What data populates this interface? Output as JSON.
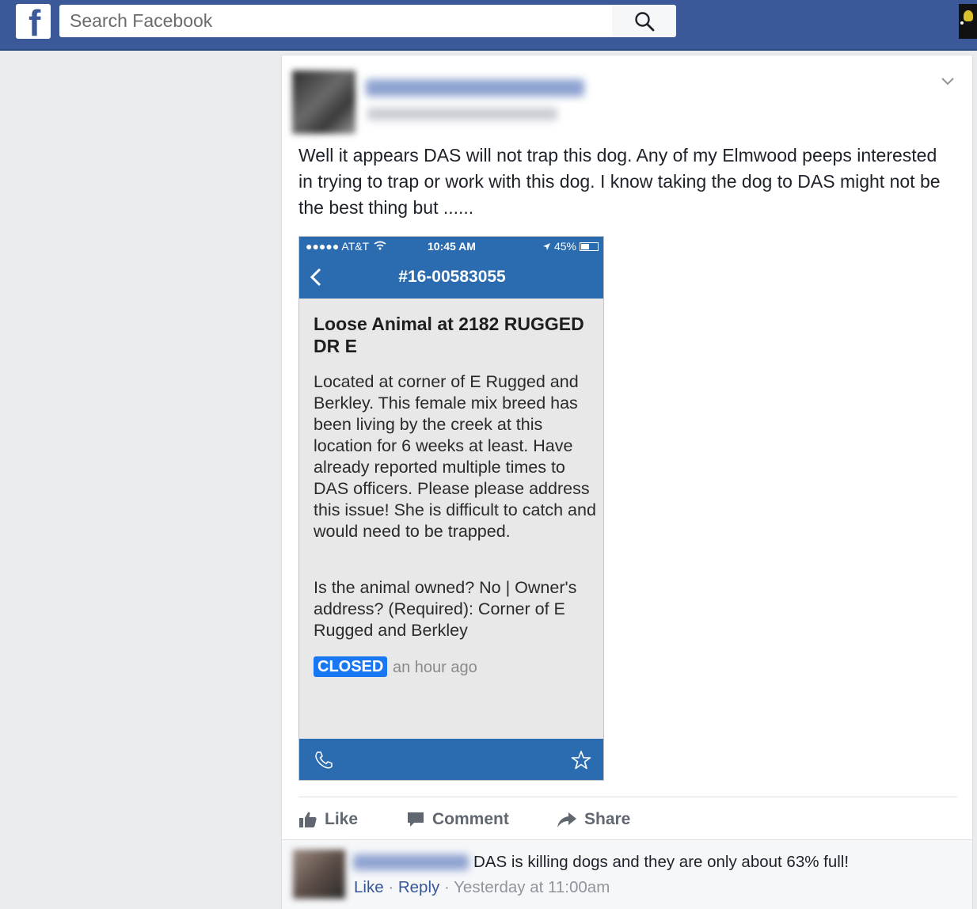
{
  "search": {
    "placeholder": "Search Facebook"
  },
  "post": {
    "text": "Well it appears DAS will not trap this dog. Any of my Elmwood peeps interested in trying to trap or work with this dog. I know taking the dog to DAS might not be the best thing but ......"
  },
  "screenshot": {
    "carrier": "●●●●● AT&T",
    "time": "10:45 AM",
    "battery": "45%",
    "case_number": "#16-00583055",
    "heading": "Loose Animal at 2182 RUGGED DR E",
    "body": "Located at corner of E Rugged and Berkley. This female mix breed has been living by the creek at this location for 6 weeks at least. Have already reported multiple times to DAS officers. Please please address this issue! She is difficult to catch and would need to be trapped.",
    "owned": "Is the animal owned? No | Owner's address? (Required): Corner of E Rugged and Berkley",
    "status": "CLOSED",
    "status_time": "an hour ago"
  },
  "actions": {
    "like": "Like",
    "comment": "Comment",
    "share": "Share"
  },
  "comment": {
    "text": "DAS is killing dogs and they are only about 63% full!",
    "like": "Like",
    "reply": "Reply",
    "separator": "·",
    "time": "Yesterday at 11:00am"
  },
  "colors": {
    "brand": "#3b5998",
    "app_blue": "#2b6cb0",
    "closed_badge": "#1877f2"
  }
}
